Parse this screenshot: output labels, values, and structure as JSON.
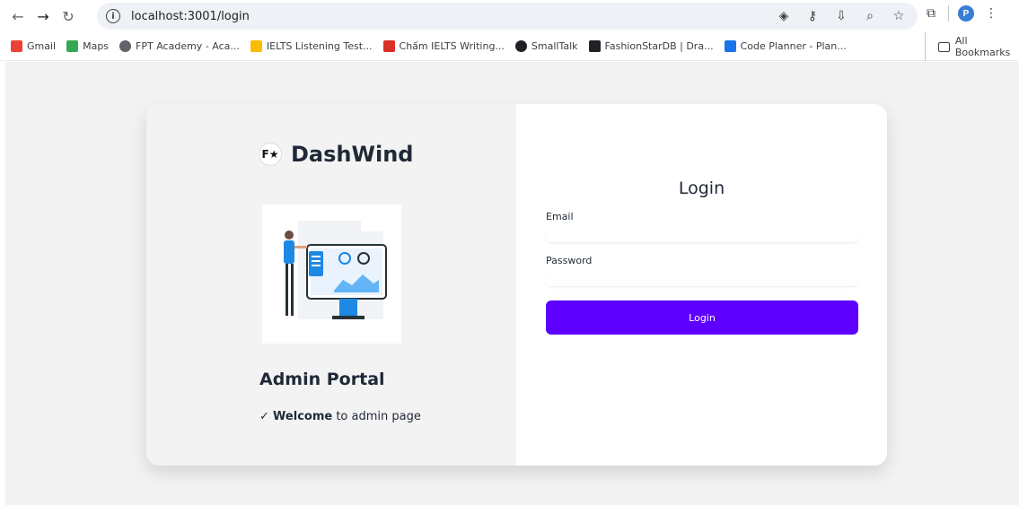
{
  "browser": {
    "url": "localhost:3001/login",
    "profile_initial": "P",
    "bookmarks": [
      {
        "label": "Gmail",
        "color": "#ea4335"
      },
      {
        "label": "Maps",
        "color": "#34a853"
      },
      {
        "label": "FPT Academy - Aca...",
        "color": "#5f6368"
      },
      {
        "label": "IELTS Listening Test...",
        "color": "#fbbc04"
      },
      {
        "label": "Chấm IELTS Writing...",
        "color": "#d93025"
      },
      {
        "label": "SmallTalk",
        "color": "#202124"
      },
      {
        "label": "FashionStarDB | Dra...",
        "color": "#202124"
      },
      {
        "label": "Code Planner - Plan...",
        "color": "#1a73e8"
      }
    ],
    "all_bookmarks_label": "All Bookmarks"
  },
  "brand": {
    "name": "DashWind",
    "logo_text": "F★"
  },
  "left_panel": {
    "title": "Admin Portal",
    "welcome_bold": "Welcome",
    "welcome_rest": " to admin page",
    "check": "✓"
  },
  "login_form": {
    "title": "Login",
    "email_label": "Email",
    "email_value": "",
    "password_label": "Password",
    "password_value": "",
    "submit_label": "Login"
  },
  "colors": {
    "primary_button": "#5d00ff",
    "page_background": "#f2f2f2"
  }
}
